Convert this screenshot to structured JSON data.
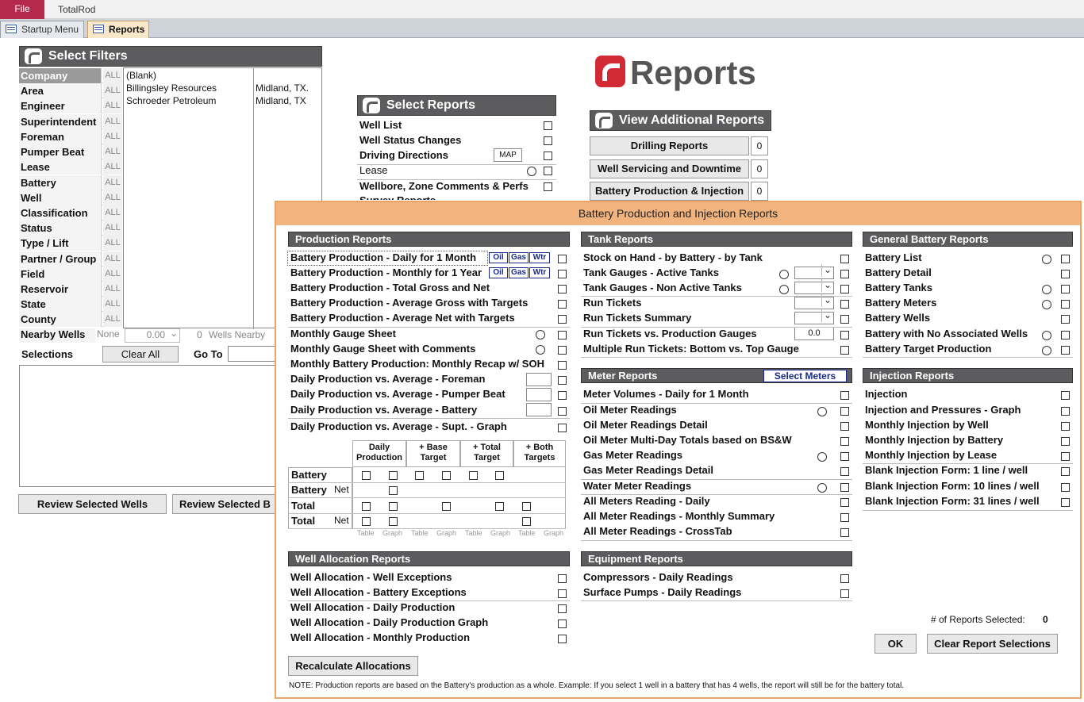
{
  "app": {
    "file_tab": "File",
    "title": "TotalRod"
  },
  "tabs": [
    {
      "label": "Startup Menu"
    },
    {
      "label": "Reports"
    }
  ],
  "reports_title": "Reports",
  "filters": {
    "header": "Select Filters",
    "rows": [
      {
        "label": "Company",
        "all": "ALL"
      },
      {
        "label": "Area",
        "all": "ALL"
      },
      {
        "label": "Engineer",
        "all": "ALL"
      },
      {
        "label": "Superintendent",
        "all": "ALL"
      },
      {
        "label": "Foreman",
        "all": "ALL"
      },
      {
        "label": "Pumper Beat",
        "all": "ALL"
      },
      {
        "label": "Lease",
        "all": "ALL"
      },
      {
        "label": "Battery",
        "all": "ALL"
      },
      {
        "label": "Well",
        "all": "ALL"
      },
      {
        "label": "Classification",
        "all": "ALL"
      },
      {
        "label": "Status",
        "all": "ALL"
      },
      {
        "label": "Type / Lift",
        "all": "ALL"
      },
      {
        "label": "Partner / Group",
        "all": "ALL"
      },
      {
        "label": "Field",
        "all": "ALL"
      },
      {
        "label": "Reservoir",
        "all": "ALL"
      },
      {
        "label": "State",
        "all": "ALL"
      },
      {
        "label": "County",
        "all": "ALL"
      }
    ],
    "company_list": [
      {
        "name": "(Blank)",
        "city": ""
      },
      {
        "name": "Billingsley Resources",
        "city": "Midland, TX."
      },
      {
        "name": "Schroeder Petroleum",
        "city": "Midland, TX"
      }
    ],
    "nearby": {
      "label": "Nearby Wells",
      "none": "None",
      "value": "0.00",
      "count": "0",
      "suffix": "Wells Nearby"
    },
    "selections_label": "Selections",
    "clear_all": "Clear All",
    "goto_label": "Go To",
    "review_wells": "Review Selected Wells",
    "review_b": "Review Selected B"
  },
  "select_reports": {
    "header": "Select Reports",
    "items": [
      "Well List",
      "Well Status Changes",
      "Driving Directions",
      "Lease",
      "Wellbore, Zone Comments & Perfs",
      "Survey Reports"
    ],
    "map_label": "MAP"
  },
  "additional": {
    "header": "View Additional Reports",
    "items": [
      {
        "label": "Drilling Reports",
        "count": "0"
      },
      {
        "label": "Well Servicing and Downtime",
        "count": "0"
      },
      {
        "label": "Battery Production & Injection",
        "count": "0"
      }
    ]
  },
  "popup": {
    "title": "Battery Production and Injection Reports",
    "production": {
      "header": "Production Reports",
      "items": [
        "Battery Production - Daily for 1 Month",
        "Battery Production - Monthly for 1 Year",
        "Battery Production - Total Gross and Net",
        "Battery Production - Average Gross with Targets",
        "Battery Production - Average Net with Targets",
        "Monthly Gauge Sheet",
        "Monthly Gauge Sheet with Comments",
        "Monthly Battery Production: Monthly Recap w/ SOH",
        "Daily Production vs. Average - Foreman",
        "Daily Production vs. Average - Pumper Beat",
        "Daily Production vs. Average - Battery",
        "Daily Production vs. Average - Supt. - Graph"
      ],
      "oil": "Oil",
      "gas": "Gas",
      "wtr": "Wtr",
      "grid": {
        "col_heads": [
          "Daily Production",
          "+ Base Target",
          "+ Total Target",
          "+ Both Targets"
        ],
        "rows": [
          {
            "label": "Battery",
            "sub": ""
          },
          {
            "label": "Battery",
            "sub": "Net"
          },
          {
            "label": "Total",
            "sub": ""
          },
          {
            "label": "Total",
            "sub": "Net"
          }
        ],
        "table_label": "Table",
        "graph_label": "Graph"
      }
    },
    "tank": {
      "header": "Tank Reports",
      "items": [
        "Stock on Hand - by Battery - by Tank",
        "Tank Gauges - Active Tanks",
        "Tank Gauges - Non Active Tanks",
        "Run Tickets",
        "Run Tickets Summary",
        "Run Tickets vs. Production Gauges",
        "Multiple Run Tickets: Bottom vs. Top Gauge"
      ],
      "gauge_value": "0.0"
    },
    "general": {
      "header": "General Battery Reports",
      "items": [
        "Battery List",
        "Battery Detail",
        "Battery Tanks",
        "Battery Meters",
        "Battery Wells",
        "Battery with No Associated Wells",
        "Battery Target Production"
      ]
    },
    "meter": {
      "header": "Meter Reports",
      "select_btn": "Select Meters",
      "items": [
        "Meter Volumes - Daily for 1 Month",
        "Oil Meter Readings",
        "Oil Meter Readings Detail",
        "Oil Meter Multi-Day Totals based on BS&W",
        "Gas Meter Readings",
        "Gas Meter Readings Detail",
        "Water Meter Readings",
        "All Meters Reading - Daily",
        "All Meter Readings - Monthly Summary",
        "All Meter Readings - CrossTab"
      ]
    },
    "injection": {
      "header": "Injection Reports",
      "items": [
        "Injection",
        "Injection and Pressures - Graph",
        "Monthly Injection by Well",
        "Monthly Injection by Battery",
        "Monthly Injection by Lease",
        "Blank Injection Form:     1 line  / well",
        "Blank Injection Form: 10 lines / well",
        "Blank Injection Form: 31 lines / well"
      ]
    },
    "well_alloc": {
      "header": "Well Allocation Reports",
      "items": [
        "Well Allocation - Well Exceptions",
        "Well Allocation - Battery Exceptions",
        "Well Allocation - Daily Production",
        "Well Allocation - Daily Production Graph",
        "Well Allocation - Monthly Production"
      ],
      "recalc": "Recalculate Allocations"
    },
    "equipment": {
      "header": "Equipment Reports",
      "items": [
        "Compressors - Daily Readings",
        "Surface Pumps - Daily Readings"
      ]
    },
    "count_label": "# of Reports Selected:",
    "count_value": "0",
    "ok": "OK",
    "clear": "Clear Report Selections",
    "note": "NOTE:  Production reports are based on the Battery's production as a whole.  Example: If you select 1 well in a battery that has 4 wells, the report will still be for the battery total."
  }
}
